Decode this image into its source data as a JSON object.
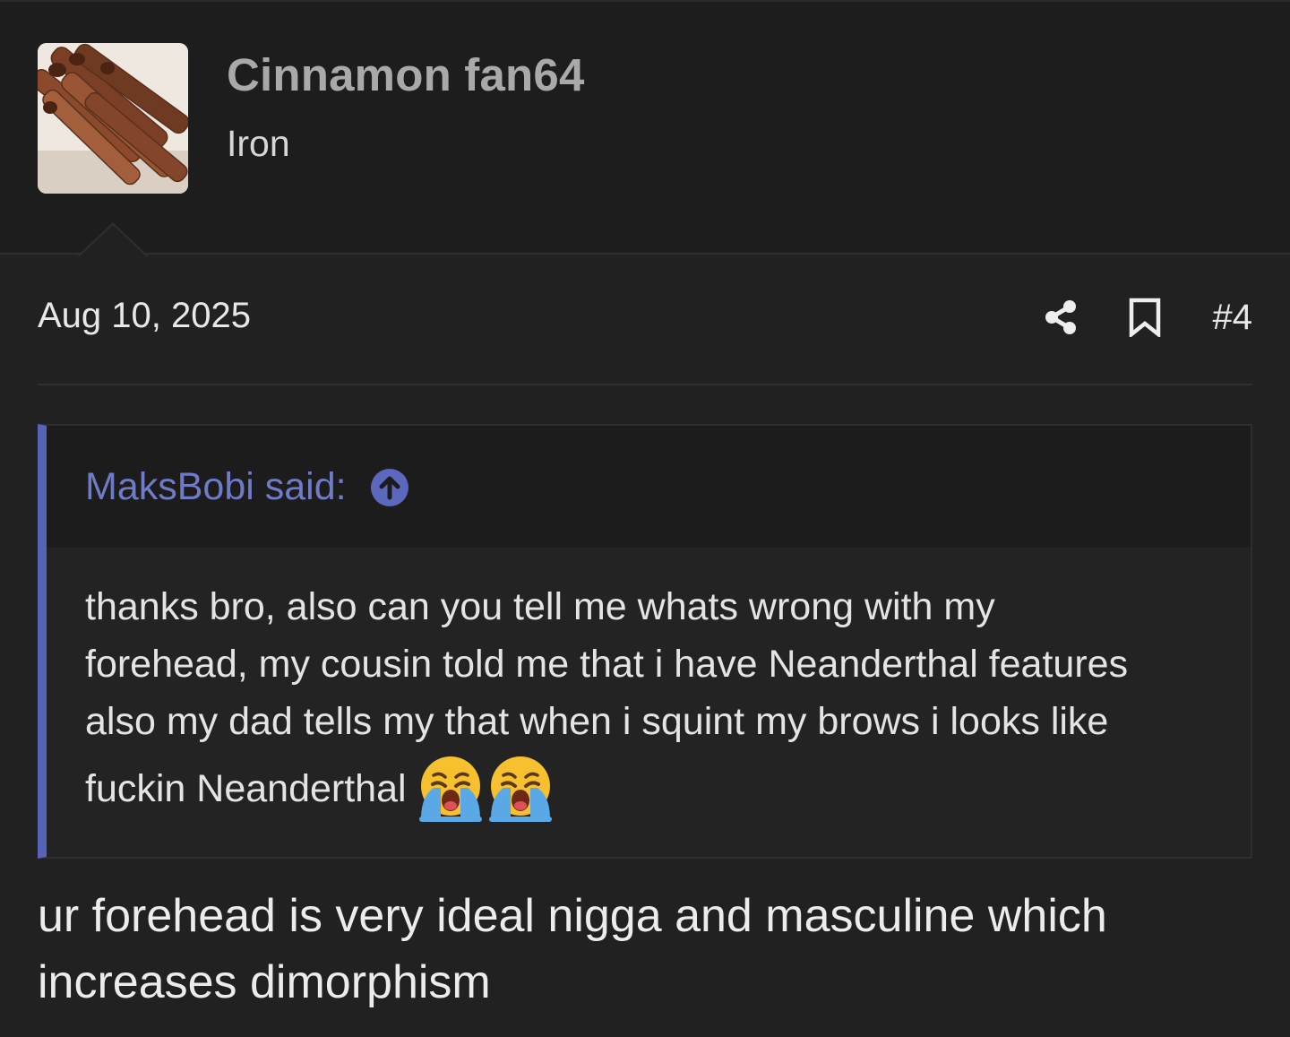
{
  "user": {
    "name": "Cinnamon fan64",
    "title": "Iron",
    "avatar_icon": "cinnamon-sticks-avatar"
  },
  "post": {
    "date": "Aug 10, 2025",
    "number": "#4",
    "share_icon": "share-icon",
    "bookmark_icon": "bookmark-icon"
  },
  "quote": {
    "author_label": "MaksBobi said:",
    "goto_icon": "arrow-up-circle-icon",
    "accent": "#5664b8",
    "lines": [
      "thanks bro, also can you tell me whats wrong with my",
      "forehead, my cousin told me that i have Neanderthal features",
      "also my dad tells my that when i squint my brows i looks like",
      "fuckin Neanderthal"
    ],
    "emojis": [
      "loudly-crying-face-emoji",
      "loudly-crying-face-emoji"
    ]
  },
  "reply": {
    "lines": [
      "ur forehead is very ideal nigga and masculine which",
      "increases dimorphism"
    ]
  }
}
